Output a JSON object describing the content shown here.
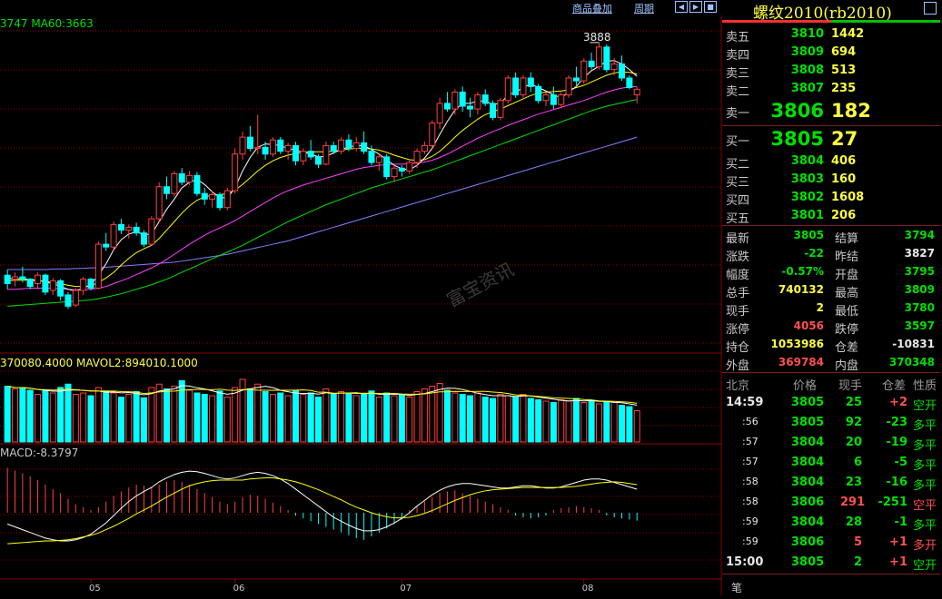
{
  "toolbar": {
    "overlay_label": "商品叠加",
    "period_label": "周期"
  },
  "indicators": {
    "ma_text": "3747 MA60:3663",
    "vol_text": "370080.4000 MAVOL2:894010.1000",
    "macd_text": "MACD:-8.3797",
    "peak_label": "3888"
  },
  "watermark": "富宝资讯",
  "panel": {
    "title": "螺纹2010(rb2010)",
    "asks": [
      {
        "label": "卖五",
        "price": "3810",
        "vol": "1442"
      },
      {
        "label": "卖四",
        "price": "3809",
        "vol": "694"
      },
      {
        "label": "卖三",
        "price": "3808",
        "vol": "513"
      },
      {
        "label": "卖二",
        "price": "3807",
        "vol": "235"
      },
      {
        "label": "卖一",
        "price": "3806",
        "vol": "182"
      }
    ],
    "bids": [
      {
        "label": "买一",
        "price": "3805",
        "vol": "27"
      },
      {
        "label": "买二",
        "price": "3804",
        "vol": "406"
      },
      {
        "label": "买三",
        "price": "3803",
        "vol": "160"
      },
      {
        "label": "买四",
        "price": "3802",
        "vol": "1608"
      },
      {
        "label": "买五",
        "price": "3801",
        "vol": "206"
      }
    ],
    "stats": [
      {
        "l1": "最新",
        "v1": "3805",
        "c1": "green",
        "l2": "结算",
        "v2": "3794",
        "c2": "green"
      },
      {
        "l1": "涨跌",
        "v1": "-22",
        "c1": "green",
        "l2": "昨结",
        "v2": "3827",
        "c2": "white"
      },
      {
        "l1": "幅度",
        "v1": "-0.57%",
        "c1": "green",
        "l2": "开盘",
        "v2": "3795",
        "c2": "green"
      },
      {
        "l1": "总手",
        "v1": "740132",
        "c1": "yellow",
        "l2": "最高",
        "v2": "3809",
        "c2": "green"
      },
      {
        "l1": "现手",
        "v1": "2",
        "c1": "yellow",
        "l2": "最低",
        "v2": "3780",
        "c2": "green"
      },
      {
        "l1": "涨停",
        "v1": "4056",
        "c1": "red",
        "l2": "跌停",
        "v2": "3597",
        "c2": "green"
      },
      {
        "l1": "持仓",
        "v1": "1053986",
        "c1": "yellow",
        "l2": "仓差",
        "v2": "-10831",
        "c2": "white"
      },
      {
        "l1": "外盘",
        "v1": "369784",
        "c1": "red",
        "l2": "内盘",
        "v2": "370348",
        "c2": "green"
      }
    ],
    "trades_header": [
      "北京",
      "价格",
      "现手",
      "仓差",
      "性质"
    ],
    "trades": [
      {
        "time": "14:59",
        "price": "3805",
        "vol": "25",
        "diff": "+2",
        "nature": "空开",
        "dc": "red",
        "nc": "green"
      },
      {
        "time": ":56",
        "price": "3805",
        "vol": "92",
        "diff": "-23",
        "nature": "多平",
        "dc": "green",
        "nc": "green"
      },
      {
        "time": ":57",
        "price": "3804",
        "vol": "20",
        "diff": "-19",
        "nature": "多平",
        "dc": "green",
        "nc": "green"
      },
      {
        "time": ":57",
        "price": "3804",
        "vol": "6",
        "diff": "-5",
        "nature": "多平",
        "dc": "green",
        "nc": "green"
      },
      {
        "time": ":58",
        "price": "3804",
        "vol": "23",
        "diff": "-16",
        "nature": "多平",
        "dc": "green",
        "nc": "green"
      },
      {
        "time": ":58",
        "price": "3806",
        "vol": "291",
        "diff": "-251",
        "nature": "空平",
        "dc": "green",
        "nc": "red"
      },
      {
        "time": ":59",
        "price": "3804",
        "vol": "28",
        "diff": "-1",
        "nature": "多平",
        "dc": "green",
        "nc": "green"
      },
      {
        "time": ":59",
        "price": "3806",
        "vol": "5",
        "diff": "+1",
        "nature": "多开",
        "dc": "red",
        "nc": "red"
      },
      {
        "time": "15:00",
        "price": "3805",
        "vol": "2",
        "diff": "+1",
        "nature": "空开",
        "dc": "red",
        "nc": "green"
      }
    ],
    "footer_tab": "笔"
  },
  "colors": {
    "up": "#ff4040",
    "down": "#00ffff",
    "ma_white": "#ffffff",
    "ma_yellow": "#ffff00",
    "ma_magenta": "#ff40ff",
    "ma_green": "#00e000",
    "ma_blue": "#8080ff",
    "grid": "#8a0000"
  },
  "chart_data": {
    "type": "candlestick",
    "x_ticks": [
      "05",
      "06",
      "07",
      "08"
    ],
    "y_range": [
      3340,
      3920
    ],
    "ohlc": [
      [
        3475,
        3485,
        3450,
        3460
      ],
      [
        3468,
        3480,
        3455,
        3472
      ],
      [
        3472,
        3490,
        3462,
        3468
      ],
      [
        3468,
        3470,
        3450,
        3455
      ],
      [
        3460,
        3480,
        3450,
        3475
      ],
      [
        3475,
        3478,
        3440,
        3445
      ],
      [
        3448,
        3470,
        3440,
        3465
      ],
      [
        3465,
        3468,
        3430,
        3438
      ],
      [
        3440,
        3445,
        3415,
        3420
      ],
      [
        3422,
        3452,
        3418,
        3448
      ],
      [
        3448,
        3472,
        3440,
        3468
      ],
      [
        3468,
        3470,
        3448,
        3452
      ],
      [
        3452,
        3535,
        3450,
        3530
      ],
      [
        3530,
        3550,
        3518,
        3525
      ],
      [
        3525,
        3570,
        3520,
        3565
      ],
      [
        3565,
        3575,
        3548,
        3555
      ],
      [
        3555,
        3565,
        3540,
        3560
      ],
      [
        3560,
        3568,
        3545,
        3550
      ],
      [
        3550,
        3555,
        3525,
        3530
      ],
      [
        3530,
        3580,
        3528,
        3575
      ],
      [
        3575,
        3640,
        3570,
        3632
      ],
      [
        3632,
        3650,
        3610,
        3620
      ],
      [
        3620,
        3660,
        3615,
        3655
      ],
      [
        3655,
        3665,
        3635,
        3640
      ],
      [
        3640,
        3660,
        3635,
        3652
      ],
      [
        3652,
        3658,
        3615,
        3620
      ],
      [
        3620,
        3630,
        3600,
        3610
      ],
      [
        3610,
        3625,
        3595,
        3618
      ],
      [
        3618,
        3622,
        3590,
        3595
      ],
      [
        3595,
        3630,
        3590,
        3625
      ],
      [
        3625,
        3700,
        3620,
        3690
      ],
      [
        3690,
        3730,
        3680,
        3720
      ],
      [
        3720,
        3740,
        3695,
        3700
      ],
      [
        3700,
        3760,
        3690,
        3702
      ],
      [
        3702,
        3712,
        3680,
        3690
      ],
      [
        3690,
        3720,
        3685,
        3715
      ],
      [
        3715,
        3720,
        3690,
        3695
      ],
      [
        3695,
        3710,
        3680,
        3705
      ],
      [
        3705,
        3712,
        3670,
        3678
      ],
      [
        3678,
        3700,
        3670,
        3695
      ],
      [
        3695,
        3715,
        3680,
        3685
      ],
      [
        3685,
        3690,
        3665,
        3672
      ],
      [
        3672,
        3712,
        3670,
        3705
      ],
      [
        3705,
        3712,
        3690,
        3695
      ],
      [
        3695,
        3720,
        3690,
        3715
      ],
      [
        3715,
        3725,
        3695,
        3700
      ],
      [
        3700,
        3720,
        3695,
        3710
      ],
      [
        3710,
        3730,
        3690,
        3695
      ],
      [
        3695,
        3705,
        3670,
        3675
      ],
      [
        3675,
        3690,
        3660,
        3685
      ],
      [
        3685,
        3690,
        3645,
        3650
      ],
      [
        3650,
        3670,
        3640,
        3665
      ],
      [
        3665,
        3670,
        3650,
        3660
      ],
      [
        3660,
        3680,
        3655,
        3675
      ],
      [
        3675,
        3700,
        3665,
        3695
      ],
      [
        3695,
        3712,
        3690,
        3705
      ],
      [
        3705,
        3750,
        3700,
        3745
      ],
      [
        3745,
        3790,
        3735,
        3780
      ],
      [
        3780,
        3800,
        3765,
        3770
      ],
      [
        3770,
        3805,
        3760,
        3800
      ],
      [
        3800,
        3810,
        3765,
        3775
      ],
      [
        3775,
        3790,
        3755,
        3770
      ],
      [
        3770,
        3800,
        3760,
        3795
      ],
      [
        3795,
        3805,
        3775,
        3780
      ],
      [
        3780,
        3785,
        3750,
        3755
      ],
      [
        3755,
        3790,
        3750,
        3785
      ],
      [
        3785,
        3830,
        3780,
        3825
      ],
      [
        3825,
        3835,
        3790,
        3795
      ],
      [
        3795,
        3830,
        3790,
        3825
      ],
      [
        3825,
        3835,
        3800,
        3810
      ],
      [
        3810,
        3815,
        3780,
        3785
      ],
      [
        3785,
        3800,
        3775,
        3795
      ],
      [
        3795,
        3810,
        3770,
        3778
      ],
      [
        3778,
        3800,
        3772,
        3795
      ],
      [
        3795,
        3830,
        3790,
        3825
      ],
      [
        3825,
        3845,
        3810,
        3820
      ],
      [
        3820,
        3860,
        3815,
        3855
      ],
      [
        3855,
        3870,
        3840,
        3845
      ],
      [
        3845,
        3888,
        3840,
        3880
      ],
      [
        3880,
        3885,
        3835,
        3840
      ],
      [
        3840,
        3860,
        3830,
        3850
      ],
      [
        3850,
        3865,
        3820,
        3825
      ],
      [
        3825,
        3830,
        3805,
        3808
      ],
      [
        3795,
        3809,
        3780,
        3805
      ]
    ],
    "ma_white": [
      3470,
      3468,
      3469,
      3467,
      3466,
      3463,
      3460,
      3455,
      3450,
      3447,
      3452,
      3458,
      3475,
      3495,
      3520,
      3538,
      3548,
      3552,
      3547,
      3548,
      3570,
      3592,
      3610,
      3630,
      3640,
      3645,
      3636,
      3623,
      3613,
      3612,
      3630,
      3660,
      3684,
      3702,
      3708,
      3707,
      3705,
      3700,
      3697,
      3693,
      3690,
      3685,
      3686,
      3692,
      3698,
      3703,
      3705,
      3705,
      3698,
      3690,
      3680,
      3670,
      3664,
      3662,
      3670,
      3683,
      3700,
      3725,
      3748,
      3768,
      3780,
      3780,
      3784,
      3784,
      3778,
      3780,
      3795,
      3800,
      3808,
      3815,
      3808,
      3802,
      3795,
      3790,
      3800,
      3810,
      3826,
      3838,
      3846,
      3855,
      3856,
      3850,
      3840,
      3828
    ],
    "ma_yellow": [
      3465,
      3466,
      3466,
      3466,
      3465,
      3464,
      3462,
      3460,
      3457,
      3455,
      3455,
      3456,
      3462,
      3470,
      3480,
      3493,
      3505,
      3515,
      3522,
      3528,
      3540,
      3555,
      3570,
      3585,
      3598,
      3608,
      3614,
      3617,
      3618,
      3620,
      3626,
      3636,
      3648,
      3660,
      3670,
      3678,
      3684,
      3688,
      3691,
      3693,
      3694,
      3694,
      3694,
      3695,
      3697,
      3699,
      3700,
      3700,
      3699,
      3697,
      3693,
      3688,
      3684,
      3680,
      3679,
      3680,
      3686,
      3695,
      3707,
      3720,
      3732,
      3742,
      3752,
      3760,
      3765,
      3770,
      3776,
      3782,
      3788,
      3794,
      3798,
      3800,
      3801,
      3802,
      3804,
      3808,
      3812,
      3818,
      3824,
      3830,
      3834,
      3836,
      3835,
      3832
    ],
    "ma_magenta": [
      3450,
      3450,
      3451,
      3452,
      3452,
      3452,
      3452,
      3451,
      3450,
      3449,
      3449,
      3450,
      3452,
      3455,
      3460,
      3465,
      3470,
      3476,
      3482,
      3488,
      3495,
      3503,
      3512,
      3521,
      3530,
      3538,
      3546,
      3553,
      3559,
      3565,
      3572,
      3580,
      3588,
      3596,
      3604,
      3612,
      3619,
      3625,
      3630,
      3635,
      3639,
      3643,
      3647,
      3651,
      3655,
      3659,
      3663,
      3666,
      3668,
      3670,
      3671,
      3672,
      3672,
      3673,
      3674,
      3676,
      3679,
      3684,
      3690,
      3697,
      3704,
      3711,
      3718,
      3724,
      3730,
      3735,
      3741,
      3746,
      3751,
      3756,
      3761,
      3765,
      3769,
      3773,
      3777,
      3781,
      3785,
      3790,
      3795,
      3800,
      3804,
      3807,
      3809,
      3810
    ],
    "ma_green": [
      3420,
      3421,
      3422,
      3423,
      3424,
      3425,
      3426,
      3427,
      3428,
      3429,
      3430,
      3431,
      3433,
      3436,
      3439,
      3442,
      3446,
      3450,
      3454,
      3458,
      3463,
      3468,
      3474,
      3480,
      3486,
      3492,
      3498,
      3504,
      3510,
      3516,
      3522,
      3528,
      3535,
      3542,
      3549,
      3556,
      3563,
      3570,
      3576,
      3582,
      3588,
      3594,
      3600,
      3605,
      3610,
      3615,
      3620,
      3625,
      3630,
      3634,
      3638,
      3642,
      3646,
      3650,
      3654,
      3658,
      3662,
      3667,
      3672,
      3677,
      3682,
      3687,
      3692,
      3697,
      3702,
      3707,
      3712,
      3717,
      3722,
      3727,
      3732,
      3737,
      3742,
      3747,
      3752,
      3757,
      3762,
      3767,
      3771,
      3775,
      3778,
      3781,
      3784,
      3787
    ],
    "ma_blue": [
      3485,
      3485,
      3485,
      3485,
      3485,
      3485,
      3486,
      3486,
      3486,
      3487,
      3487,
      3488,
      3488,
      3489,
      3490,
      3491,
      3492,
      3493,
      3494,
      3495,
      3496,
      3497,
      3498,
      3500,
      3502,
      3504,
      3506,
      3508,
      3510,
      3512,
      3515,
      3518,
      3521,
      3524,
      3527,
      3530,
      3533,
      3536,
      3540,
      3544,
      3548,
      3552,
      3556,
      3560,
      3564,
      3568,
      3572,
      3576,
      3580,
      3584,
      3588,
      3592,
      3596,
      3600,
      3604,
      3608,
      3612,
      3616,
      3620,
      3624,
      3628,
      3632,
      3636,
      3640,
      3644,
      3648,
      3652,
      3656,
      3660,
      3664,
      3668,
      3672,
      3676,
      3680,
      3684,
      3688,
      3692,
      3696,
      3700,
      3704,
      3708,
      3712,
      3716,
      3720
    ],
    "volume": [
      0.82,
      0.78,
      0.8,
      0.76,
      0.7,
      0.75,
      0.72,
      0.8,
      0.85,
      0.7,
      0.72,
      0.68,
      0.8,
      0.75,
      0.72,
      0.66,
      0.7,
      0.74,
      0.65,
      0.8,
      0.85,
      0.78,
      0.82,
      0.9,
      0.76,
      0.72,
      0.7,
      0.68,
      0.75,
      0.66,
      0.8,
      0.92,
      0.78,
      0.85,
      0.74,
      0.7,
      0.72,
      0.68,
      0.76,
      0.7,
      0.72,
      0.66,
      0.78,
      0.7,
      0.74,
      0.72,
      0.68,
      0.7,
      0.75,
      0.66,
      0.72,
      0.68,
      0.7,
      0.66,
      0.74,
      0.78,
      0.82,
      0.86,
      0.76,
      0.72,
      0.7,
      0.68,
      0.72,
      0.66,
      0.64,
      0.7,
      0.68,
      0.66,
      0.7,
      0.64,
      0.62,
      0.6,
      0.58,
      0.62,
      0.6,
      0.64,
      0.58,
      0.6,
      0.56,
      0.6,
      0.58,
      0.54,
      0.52,
      0.46
    ],
    "macd_hist": [
      0.8,
      0.75,
      0.7,
      0.65,
      0.58,
      0.5,
      0.42,
      0.35,
      0.25,
      0.15,
      0.1,
      0.05,
      0.1,
      0.2,
      0.3,
      0.38,
      0.45,
      0.5,
      0.48,
      0.45,
      0.5,
      0.55,
      0.58,
      0.55,
      0.5,
      0.42,
      0.35,
      0.28,
      0.2,
      0.15,
      0.2,
      0.28,
      0.32,
      0.3,
      0.25,
      0.18,
      0.12,
      0.05,
      -0.05,
      -0.1,
      -0.15,
      -0.2,
      -0.25,
      -0.3,
      -0.35,
      -0.4,
      -0.45,
      -0.48,
      -0.42,
      -0.35,
      -0.28,
      -0.2,
      -0.12,
      0.05,
      0.12,
      0.2,
      0.28,
      0.35,
      0.38,
      0.4,
      0.35,
      0.3,
      0.25,
      0.2,
      0.15,
      0.1,
      0.05,
      -0.05,
      -0.08,
      -0.1,
      -0.08,
      -0.05,
      0.05,
      0.08,
      0.1,
      0.12,
      0.1,
      0.08,
      0.05,
      -0.05,
      -0.08,
      -0.1,
      -0.12,
      -0.14
    ],
    "macd_dif": [
      -0.2,
      -0.25,
      -0.3,
      -0.35,
      -0.4,
      -0.45,
      -0.48,
      -0.5,
      -0.5,
      -0.48,
      -0.44,
      -0.38,
      -0.28,
      -0.18,
      -0.05,
      0.08,
      0.2,
      0.3,
      0.38,
      0.45,
      0.55,
      0.62,
      0.68,
      0.72,
      0.74,
      0.73,
      0.7,
      0.66,
      0.62,
      0.6,
      0.62,
      0.66,
      0.7,
      0.72,
      0.7,
      0.66,
      0.6,
      0.52,
      0.42,
      0.32,
      0.22,
      0.12,
      0.02,
      -0.08,
      -0.15,
      -0.22,
      -0.28,
      -0.32,
      -0.32,
      -0.3,
      -0.25,
      -0.18,
      -0.1,
      0.0,
      0.12,
      0.22,
      0.32,
      0.4,
      0.46,
      0.5,
      0.52,
      0.52,
      0.5,
      0.48,
      0.46,
      0.44,
      0.44,
      0.46,
      0.48,
      0.48,
      0.46,
      0.44,
      0.44,
      0.46,
      0.5,
      0.54,
      0.58,
      0.6,
      0.6,
      0.58,
      0.54,
      0.5,
      0.46,
      0.42
    ],
    "macd_dea": [
      -0.55,
      -0.54,
      -0.53,
      -0.52,
      -0.51,
      -0.5,
      -0.5,
      -0.49,
      -0.48,
      -0.46,
      -0.43,
      -0.4,
      -0.36,
      -0.3,
      -0.24,
      -0.17,
      -0.1,
      -0.02,
      0.05,
      0.12,
      0.2,
      0.28,
      0.35,
      0.42,
      0.48,
      0.52,
      0.55,
      0.57,
      0.58,
      0.58,
      0.58,
      0.58,
      0.6,
      0.61,
      0.62,
      0.62,
      0.6,
      0.58,
      0.55,
      0.51,
      0.46,
      0.41,
      0.35,
      0.29,
      0.23,
      0.16,
      0.1,
      0.05,
      0.0,
      -0.04,
      -0.07,
      -0.09,
      -0.09,
      -0.08,
      -0.05,
      -0.01,
      0.04,
      0.1,
      0.16,
      0.22,
      0.27,
      0.32,
      0.36,
      0.39,
      0.41,
      0.42,
      0.43,
      0.44,
      0.45,
      0.45,
      0.45,
      0.45,
      0.45,
      0.45,
      0.46,
      0.47,
      0.49,
      0.51,
      0.53,
      0.54,
      0.55,
      0.54,
      0.52,
      0.5
    ]
  }
}
